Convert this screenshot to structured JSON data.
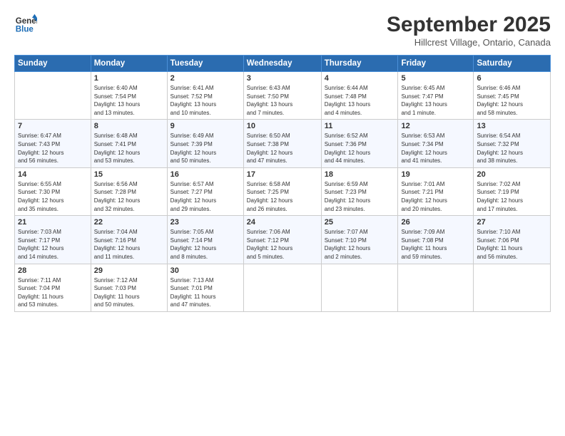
{
  "header": {
    "logo_line1": "General",
    "logo_line2": "Blue",
    "month": "September 2025",
    "location": "Hillcrest Village, Ontario, Canada"
  },
  "weekdays": [
    "Sunday",
    "Monday",
    "Tuesday",
    "Wednesday",
    "Thursday",
    "Friday",
    "Saturday"
  ],
  "weeks": [
    [
      {
        "day": "",
        "info": ""
      },
      {
        "day": "1",
        "info": "Sunrise: 6:40 AM\nSunset: 7:54 PM\nDaylight: 13 hours\nand 13 minutes."
      },
      {
        "day": "2",
        "info": "Sunrise: 6:41 AM\nSunset: 7:52 PM\nDaylight: 13 hours\nand 10 minutes."
      },
      {
        "day": "3",
        "info": "Sunrise: 6:43 AM\nSunset: 7:50 PM\nDaylight: 13 hours\nand 7 minutes."
      },
      {
        "day": "4",
        "info": "Sunrise: 6:44 AM\nSunset: 7:48 PM\nDaylight: 13 hours\nand 4 minutes."
      },
      {
        "day": "5",
        "info": "Sunrise: 6:45 AM\nSunset: 7:47 PM\nDaylight: 13 hours\nand 1 minute."
      },
      {
        "day": "6",
        "info": "Sunrise: 6:46 AM\nSunset: 7:45 PM\nDaylight: 12 hours\nand 58 minutes."
      }
    ],
    [
      {
        "day": "7",
        "info": "Sunrise: 6:47 AM\nSunset: 7:43 PM\nDaylight: 12 hours\nand 56 minutes."
      },
      {
        "day": "8",
        "info": "Sunrise: 6:48 AM\nSunset: 7:41 PM\nDaylight: 12 hours\nand 53 minutes."
      },
      {
        "day": "9",
        "info": "Sunrise: 6:49 AM\nSunset: 7:39 PM\nDaylight: 12 hours\nand 50 minutes."
      },
      {
        "day": "10",
        "info": "Sunrise: 6:50 AM\nSunset: 7:38 PM\nDaylight: 12 hours\nand 47 minutes."
      },
      {
        "day": "11",
        "info": "Sunrise: 6:52 AM\nSunset: 7:36 PM\nDaylight: 12 hours\nand 44 minutes."
      },
      {
        "day": "12",
        "info": "Sunrise: 6:53 AM\nSunset: 7:34 PM\nDaylight: 12 hours\nand 41 minutes."
      },
      {
        "day": "13",
        "info": "Sunrise: 6:54 AM\nSunset: 7:32 PM\nDaylight: 12 hours\nand 38 minutes."
      }
    ],
    [
      {
        "day": "14",
        "info": "Sunrise: 6:55 AM\nSunset: 7:30 PM\nDaylight: 12 hours\nand 35 minutes."
      },
      {
        "day": "15",
        "info": "Sunrise: 6:56 AM\nSunset: 7:28 PM\nDaylight: 12 hours\nand 32 minutes."
      },
      {
        "day": "16",
        "info": "Sunrise: 6:57 AM\nSunset: 7:27 PM\nDaylight: 12 hours\nand 29 minutes."
      },
      {
        "day": "17",
        "info": "Sunrise: 6:58 AM\nSunset: 7:25 PM\nDaylight: 12 hours\nand 26 minutes."
      },
      {
        "day": "18",
        "info": "Sunrise: 6:59 AM\nSunset: 7:23 PM\nDaylight: 12 hours\nand 23 minutes."
      },
      {
        "day": "19",
        "info": "Sunrise: 7:01 AM\nSunset: 7:21 PM\nDaylight: 12 hours\nand 20 minutes."
      },
      {
        "day": "20",
        "info": "Sunrise: 7:02 AM\nSunset: 7:19 PM\nDaylight: 12 hours\nand 17 minutes."
      }
    ],
    [
      {
        "day": "21",
        "info": "Sunrise: 7:03 AM\nSunset: 7:17 PM\nDaylight: 12 hours\nand 14 minutes."
      },
      {
        "day": "22",
        "info": "Sunrise: 7:04 AM\nSunset: 7:16 PM\nDaylight: 12 hours\nand 11 minutes."
      },
      {
        "day": "23",
        "info": "Sunrise: 7:05 AM\nSunset: 7:14 PM\nDaylight: 12 hours\nand 8 minutes."
      },
      {
        "day": "24",
        "info": "Sunrise: 7:06 AM\nSunset: 7:12 PM\nDaylight: 12 hours\nand 5 minutes."
      },
      {
        "day": "25",
        "info": "Sunrise: 7:07 AM\nSunset: 7:10 PM\nDaylight: 12 hours\nand 2 minutes."
      },
      {
        "day": "26",
        "info": "Sunrise: 7:09 AM\nSunset: 7:08 PM\nDaylight: 11 hours\nand 59 minutes."
      },
      {
        "day": "27",
        "info": "Sunrise: 7:10 AM\nSunset: 7:06 PM\nDaylight: 11 hours\nand 56 minutes."
      }
    ],
    [
      {
        "day": "28",
        "info": "Sunrise: 7:11 AM\nSunset: 7:04 PM\nDaylight: 11 hours\nand 53 minutes."
      },
      {
        "day": "29",
        "info": "Sunrise: 7:12 AM\nSunset: 7:03 PM\nDaylight: 11 hours\nand 50 minutes."
      },
      {
        "day": "30",
        "info": "Sunrise: 7:13 AM\nSunset: 7:01 PM\nDaylight: 11 hours\nand 47 minutes."
      },
      {
        "day": "",
        "info": ""
      },
      {
        "day": "",
        "info": ""
      },
      {
        "day": "",
        "info": ""
      },
      {
        "day": "",
        "info": ""
      }
    ]
  ]
}
